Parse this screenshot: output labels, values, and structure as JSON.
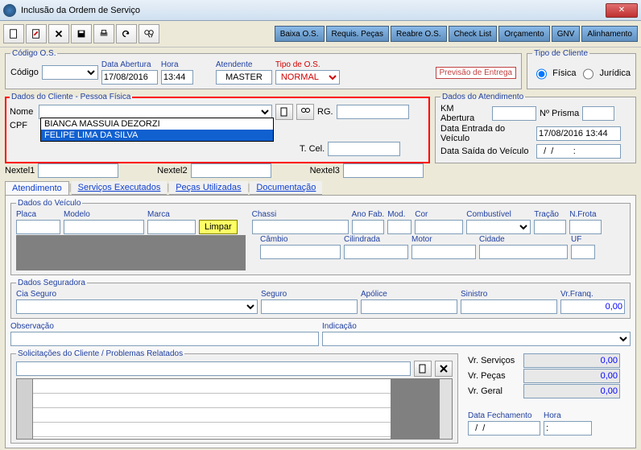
{
  "window": {
    "title": "Inclusão da Ordem de Serviço"
  },
  "actionButtons": [
    "Baixa O.S.",
    "Requis. Peças",
    "Reabre O.S.",
    "Check List",
    "Orçamento",
    "GNV",
    "Alinhamento"
  ],
  "codigoos": {
    "legend": "Código O.S.",
    "codigo_label": "Código",
    "data_abertura_label": "Data Abertura",
    "data_abertura": "17/08/2016",
    "hora_label": "Hora",
    "hora": "13:44",
    "atendente_label": "Atendente",
    "atendente": "MASTER",
    "tipo_os_label": "Tipo de O.S.",
    "tipo_os": "NORMAL",
    "previsao": "Previsão de Entrega"
  },
  "tipoCliente": {
    "legend": "Tipo de Cliente",
    "fisica": "Física",
    "juridica": "Jurídica"
  },
  "dadosCliente": {
    "legend": "Dados do Cliente  -  Pessoa Física",
    "nome_label": "Nome",
    "cpf_label": "CPF",
    "rg_label": "RG.",
    "tcel_label": "T. Cel.",
    "nextel1_label": "Nextel1",
    "nextel2_label": "Nextel2",
    "nextel3_label": "Nextel3",
    "dropdown": [
      "BIANCA MASSUIA DEZORZI",
      "FELIPE LIMA DA SILVA"
    ]
  },
  "dadosAtend": {
    "legend": "Dados do Atendimento",
    "km_label": "KM Abertura",
    "prisma_label": "Nº Prisma",
    "entrada_label": "Data Entrada do Veículo",
    "entrada": "17/08/2016 13:44",
    "saida_label": "Data Saída do Veículo",
    "saida": "  /  /        :"
  },
  "tabs": [
    "Atendimento",
    "Serviços Executados",
    "Peças Utilizadas",
    "Documentação"
  ],
  "veiculo": {
    "legend": "Dados do Veículo",
    "placa": "Placa",
    "modelo": "Modelo",
    "marca": "Marca",
    "limpar": "Limpar",
    "chassi": "Chassi",
    "anofab": "Ano Fab.",
    "mod": "Mod.",
    "cor": "Cor",
    "combustivel": "Combustível",
    "tracao": "Tração",
    "nfrota": "N.Frota",
    "cambio": "Câmbio",
    "cilindrada": "Cilindrada",
    "motor": "Motor",
    "cidade": "Cidade",
    "uf": "UF"
  },
  "seguradora": {
    "legend": "Dados Seguradora",
    "cia": "Cia Seguro",
    "seguro": "Seguro",
    "apolice": "Apólice",
    "sinistro": "Sinistro",
    "vrfranq": "Vr.Franq.",
    "vrfranq_val": "0,00"
  },
  "observ": {
    "obs": "Observação",
    "ind": "Indicação"
  },
  "solic": {
    "legend": "Solicitações do Cliente / Problemas Relatados"
  },
  "totals": {
    "vrserv": "Vr. Serviços",
    "vrserv_val": "0,00",
    "vrpecas": "Vr. Peças",
    "vrpecas_val": "0,00",
    "vrgeral": "Vr. Geral",
    "vrgeral_val": "0,00",
    "datafech": "Data Fechamento",
    "hora": "Hora",
    "datafech_val": "  /  /",
    "hora_val": ":"
  }
}
